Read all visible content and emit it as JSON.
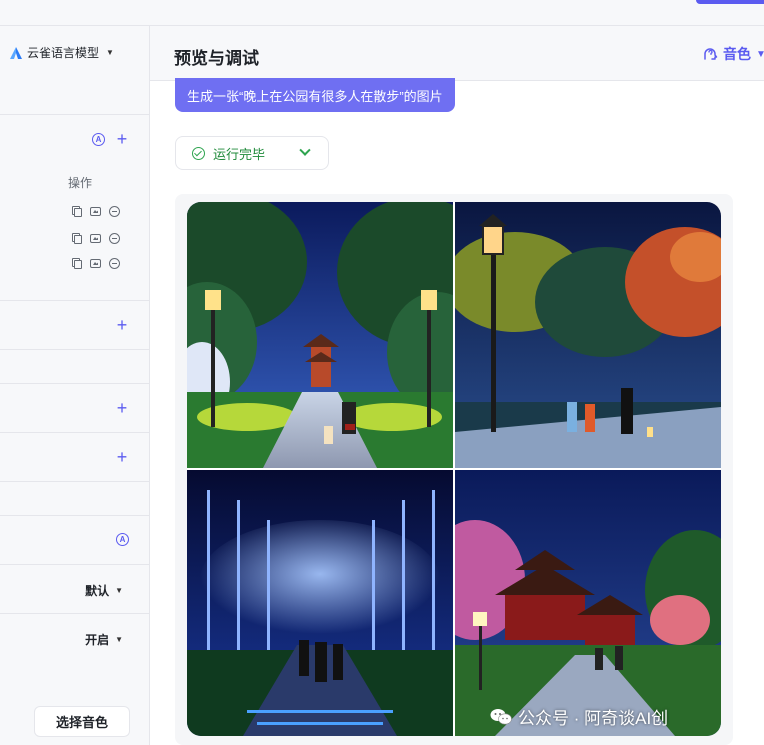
{
  "sidebar": {
    "model_name": "云雀语言模型",
    "ops_label": "操作",
    "select_default": "默认",
    "select_on": "开启",
    "voice_button": "选择音色"
  },
  "main": {
    "title": "预览与调试",
    "voice_tab": "音色",
    "prompt": "生成一张“晚上在公园有很多人在散步”的图片",
    "status": "运行完毕"
  },
  "watermark": "公众号 · 阿奇谈AI创",
  "colors": {
    "accent": "#5b5bf0",
    "bubble": "#6f6ff2",
    "success": "#2ea44f"
  }
}
